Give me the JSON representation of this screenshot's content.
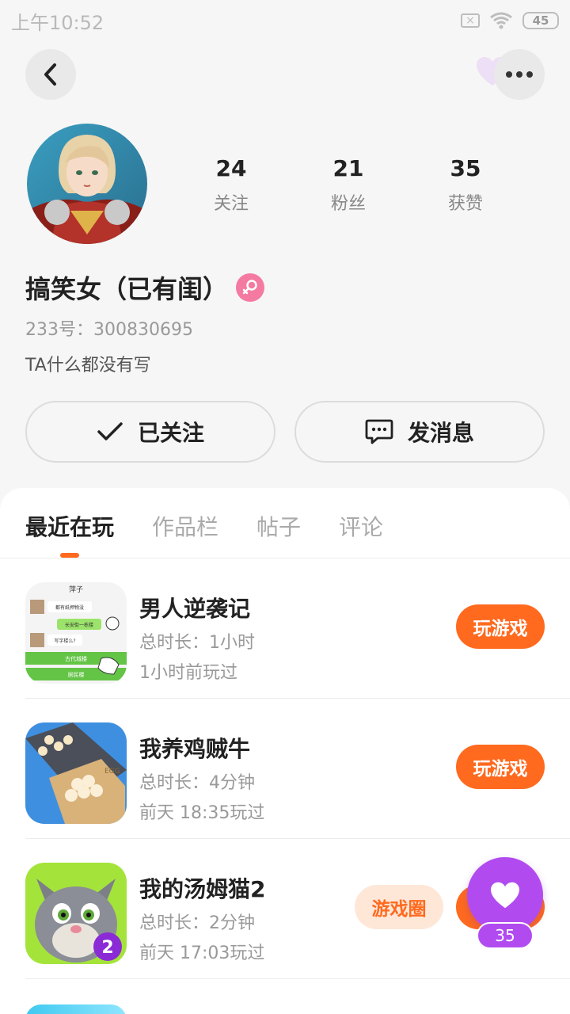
{
  "status_bar": {
    "time": "上午10:52",
    "battery": "45"
  },
  "profile": {
    "stats": [
      {
        "num": "24",
        "label": "关注"
      },
      {
        "num": "21",
        "label": "粉丝"
      },
      {
        "num": "35",
        "label": "获赞"
      }
    ],
    "name": "搞笑女（已有闺）",
    "uid": "233号：300830695",
    "bio": "TA什么都没有写",
    "follow_label": "已关注",
    "message_label": "发消息"
  },
  "tabs": [
    "最近在玩",
    "作品栏",
    "帖子",
    "评论"
  ],
  "games": [
    {
      "title": "男人逆袭记",
      "duration": "总时长：1小时",
      "last_played": "1小时前玩过",
      "play_label": "玩游戏"
    },
    {
      "title": "我养鸡贼牛",
      "duration": "总时长：4分钟",
      "last_played": "前天 18:35玩过",
      "play_label": "玩游戏"
    },
    {
      "title": "我的汤姆猫2",
      "duration": "总时长：2分钟",
      "last_played": "前天 17:03玩过",
      "circle_label": "游戏圈"
    }
  ],
  "game1_icon_text": {
    "header": "萍子",
    "bubble1": "都有纸押物没",
    "bubble2": "长安街一栋楼",
    "bubble3": "写字楼么?",
    "option1": "古代城楼",
    "option2": "居民楼"
  },
  "game2_icon_text": "EGG",
  "game3_icon_text": "2",
  "fab": {
    "count": "35"
  },
  "colors": {
    "accent": "#ff6a1f",
    "fab": "#b14bf0",
    "gender": "#f47aa1"
  }
}
